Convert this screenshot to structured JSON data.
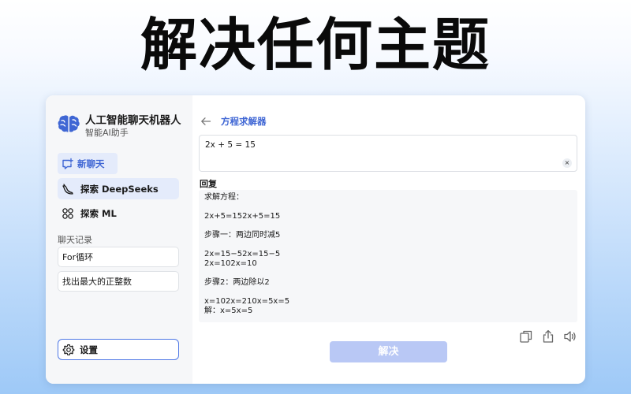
{
  "headline": "解决任何主题",
  "app": {
    "title": "人工智能聊天机器人",
    "subtitle": "智能AI助手",
    "logo_icon": "brain-icon"
  },
  "sidebar": {
    "new_chat_label": "新聊天",
    "nav": [
      {
        "label": "探索 DeepSeeks",
        "icon": "whale-icon",
        "active": true
      },
      {
        "label": "探索 ML",
        "icon": "grid-icon",
        "active": false
      }
    ],
    "history_label": "聊天记录",
    "history": [
      {
        "label": "For循环"
      },
      {
        "label": "找出最大的正整数"
      }
    ],
    "settings_label": "设置"
  },
  "main": {
    "back_icon": "arrow-left-icon",
    "title": "方程求解器",
    "input_value": "2x + 5 = 15",
    "clear_label": "×",
    "reply_label": "回复",
    "reply_lines": [
      "求解方程：",
      "",
      "2x+5=152x+5=15",
      "",
      "步骤一：两边同时减5",
      "",
      "2x=15−52x=15−5",
      "2x=102x=10",
      "",
      "步骤2：两边除以2",
      "",
      "x=102x=210x=5x=5",
      "解：x=5x=5"
    ],
    "tool_icons": [
      "copy-icon",
      "share-icon",
      "speaker-icon"
    ],
    "solve_label": "解决"
  },
  "colors": {
    "accent": "#3f66d4",
    "active_bg": "#e4ebfb",
    "solve_button": "#b9c8f5"
  }
}
